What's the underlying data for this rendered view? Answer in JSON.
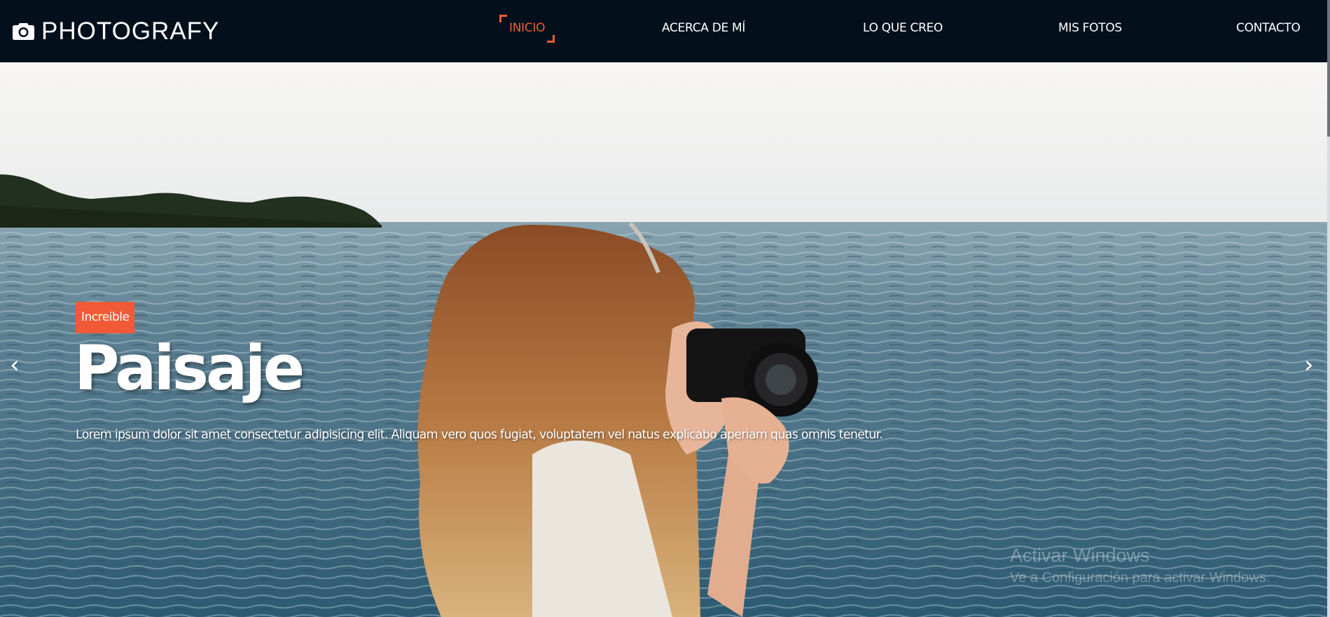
{
  "brand": {
    "name": "PHOTOGRAFY",
    "icon": "camera-icon"
  },
  "nav": {
    "items": [
      {
        "label": "INICIO",
        "active": true
      },
      {
        "label": "ACERCA DE MÍ",
        "active": false
      },
      {
        "label": "LO QUE CREO",
        "active": false
      },
      {
        "label": "MIS FOTOS",
        "active": false
      },
      {
        "label": "CONTACTO",
        "active": false
      }
    ]
  },
  "hero": {
    "tag": "Increible",
    "title": "Paisaje",
    "text": "Lorem ipsum dolor sit amet consectetur adipisicing elit. Aliquam vero quos fugiat, voluptatem vel natus explicabo aperiam quas omnis tenetur.",
    "prev_arrow": "‹",
    "next_arrow": "›"
  },
  "watermark": {
    "line1": "Activar Windows",
    "line2": "Ve a Configuración para activar Windows."
  },
  "colors": {
    "navbar": "#03101c",
    "accent": "#f15a37",
    "text": "#ffffff"
  }
}
